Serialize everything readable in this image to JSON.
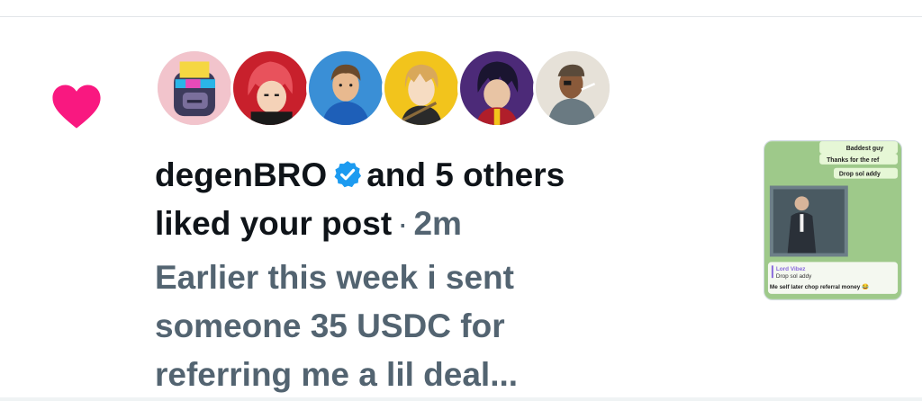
{
  "notification": {
    "type": "like",
    "user_name": "degenBRO",
    "others_text": "and 5 others",
    "action_text": "liked your post",
    "separator": "·",
    "time": "2m",
    "post_preview": "Earlier this week i sent someone 35 USDC for referring me a lil deal...",
    "heart_color": "#f91880",
    "verified_color": "#1d9bf0",
    "text_color": "#0f1419",
    "muted_color": "#536471"
  },
  "avatars": [
    {
      "name": "avatar-pixel-ape",
      "icon": "pixel-ape-avatar"
    },
    {
      "name": "avatar-red-hair-anime",
      "icon": "anime-avatar"
    },
    {
      "name": "avatar-blue-shirt",
      "icon": "cartoon-avatar"
    },
    {
      "name": "avatar-blonde-anime",
      "icon": "anime-avatar"
    },
    {
      "name": "avatar-dark-hair-anime",
      "icon": "anime-avatar"
    },
    {
      "name": "avatar-pirate",
      "icon": "pirate-avatar"
    }
  ],
  "thumbnail": {
    "messages": [
      "Baddest guy",
      "Thanks for the ref",
      "Drop sol addy"
    ],
    "reply_name": "Lord Vibez",
    "reply_text": "Drop sol addy",
    "caption": "Me self later chop referral money 😂"
  }
}
